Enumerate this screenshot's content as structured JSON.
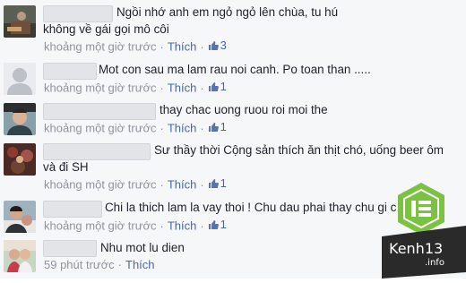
{
  "comments": [
    {
      "text": "Ngồi nhớ anh em ngỏ ngỏ lên chùa, tu hú không về gái gọi mô côi",
      "time": "khoảng một giờ trước",
      "action": "Thích",
      "likes": "3"
    },
    {
      "text": "Mot con sau ma lam rau noi canh. Po toan than .....",
      "time": "khoảng một giờ trước",
      "action": "Thích",
      "likes": "1"
    },
    {
      "text": "thay chac uong ruou roi moi the",
      "time": "khoảng một giờ trước",
      "action": "Thích",
      "likes": "1"
    },
    {
      "text": "Sư thầy thời Cộng sản thích ăn thịt chó, uống beer ôm và đi SH",
      "time": "khoảng một giờ trước",
      "action": "Thích",
      "likes": "1"
    },
    {
      "text": "Chi la thich lam la vay thoi ! Chu dau phai thay chu gi c",
      "time": "khoảng một giờ trước",
      "action": "Thích",
      "likes": "1"
    },
    {
      "text": "Nhu mot lu dien",
      "time": "59 phút trước",
      "action": "Thích",
      "likes": ""
    }
  ],
  "watermark": {
    "brand": "Kenh13",
    "suffix": ".info",
    "accent": "#7cc242",
    "dark": "#2a2a2a"
  }
}
